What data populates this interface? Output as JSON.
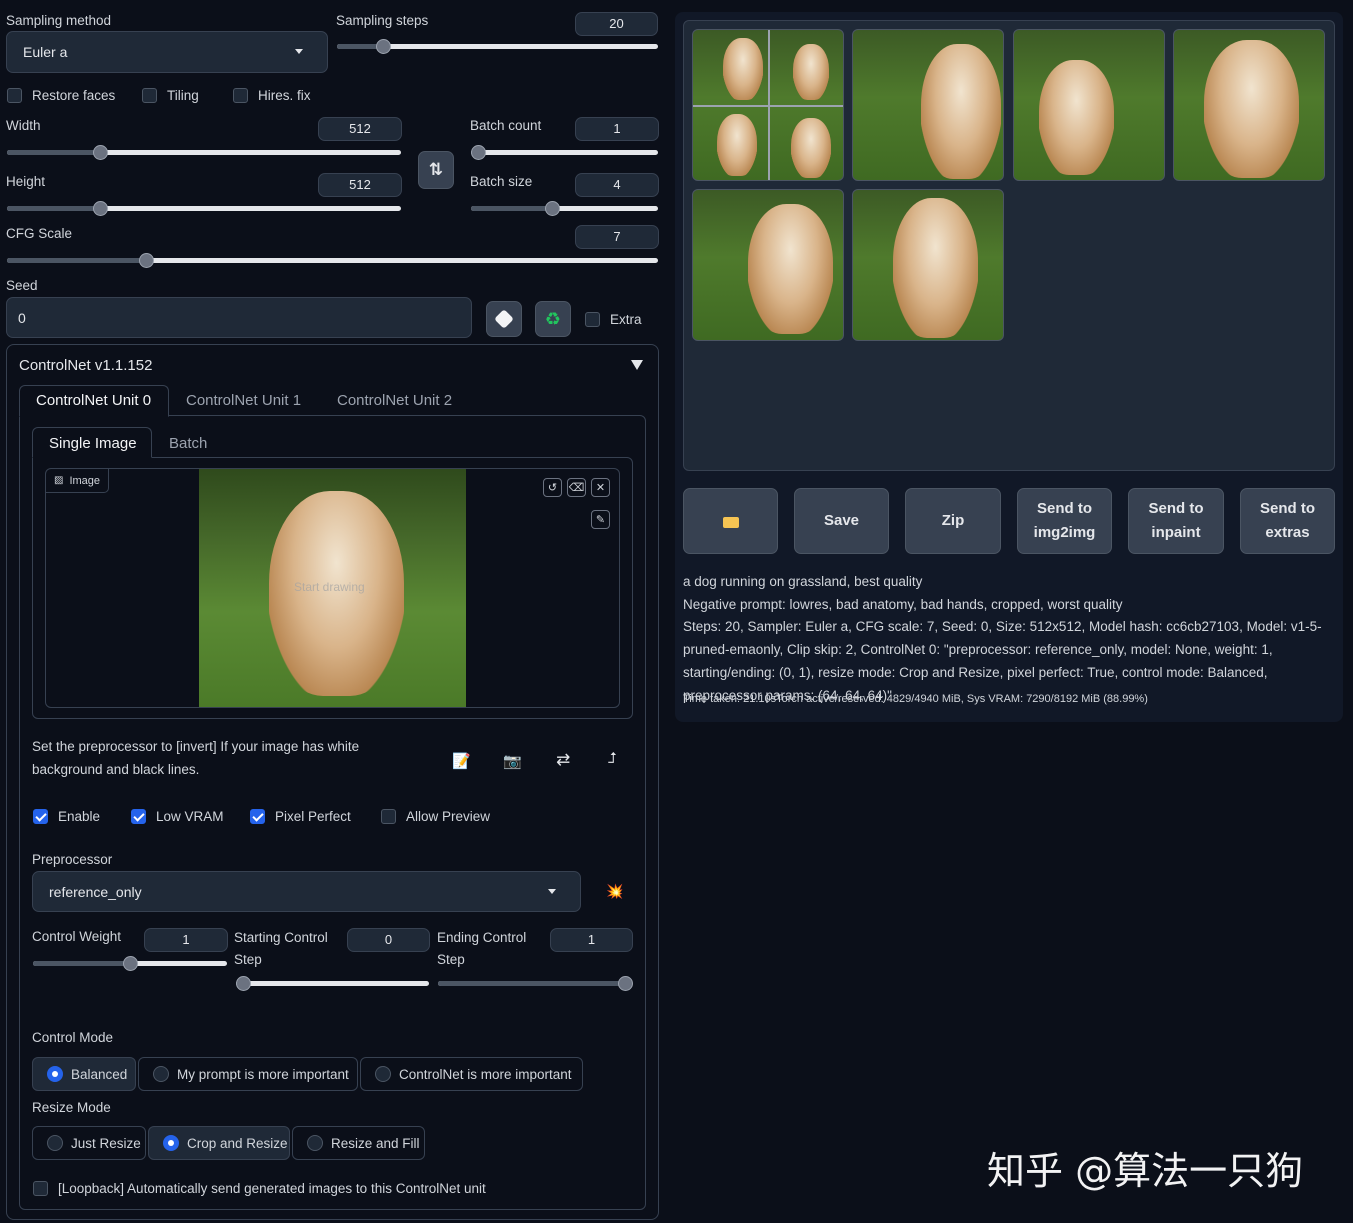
{
  "sampling": {
    "method_label": "Sampling method",
    "method_value": "Euler a",
    "steps_label": "Sampling steps",
    "steps_value": "20",
    "steps_fraction": 0.15
  },
  "options": {
    "restore_faces": "Restore faces",
    "tiling": "Tiling",
    "hires_fix": "Hires. fix"
  },
  "size": {
    "width_label": "Width",
    "width_value": "512",
    "height_label": "Height",
    "height_value": "512",
    "batch_count_label": "Batch count",
    "batch_count_value": "1",
    "batch_size_label": "Batch size",
    "batch_size_value": "4",
    "swap_icon": "swap-vertical-icon"
  },
  "cfg": {
    "label": "CFG Scale",
    "value": "7"
  },
  "seed": {
    "label": "Seed",
    "value": "0",
    "dice_icon": "dice-icon",
    "recycle_icon": "recycle-icon",
    "extra_label": "Extra"
  },
  "controlnet": {
    "title": "ControlNet v1.1.152",
    "units": [
      "ControlNet Unit 0",
      "ControlNet Unit 1",
      "ControlNet Unit 2"
    ],
    "image_tabs": [
      "Single Image",
      "Batch"
    ],
    "image_label": "Image",
    "canvas_hint": "Start drawing",
    "hint_text": "Set the preprocessor to [invert] If your image has white background and black lines.",
    "tool_icons": [
      "notepad-icon",
      "camera-icon",
      "swap-arrows-icon",
      "return-arrow-icon"
    ],
    "enable": "Enable",
    "low_vram": "Low VRAM",
    "pixel_perfect": "Pixel Perfect",
    "allow_preview": "Allow Preview",
    "preprocessor_label": "Preprocessor",
    "preprocessor_value": "reference_only",
    "explosion_icon": "explosion-icon",
    "control_weight_label": "Control Weight",
    "control_weight_value": "1",
    "start_step_label": "Starting Control Step",
    "start_step_value": "0",
    "end_step_label": "Ending Control Step",
    "end_step_value": "1",
    "control_mode_label": "Control Mode",
    "control_modes": [
      "Balanced",
      "My prompt is more important",
      "ControlNet is more important"
    ],
    "resize_mode_label": "Resize Mode",
    "resize_modes": [
      "Just Resize",
      "Crop and Resize",
      "Resize and Fill"
    ],
    "loopback": "[Loopback] Automatically send generated images to this ControlNet unit"
  },
  "actions": {
    "folder_icon": "folder-icon",
    "save": "Save",
    "zip": "Zip",
    "send_img2img": "Send to img2img",
    "send_inpaint": "Send to inpaint",
    "send_extras": "Send to extras"
  },
  "info": {
    "prompt": "a dog running on grassland, best quality",
    "negative": "Negative prompt: lowres, bad anatomy, bad hands, cropped, worst quality",
    "params": "Steps: 20, Sampler: Euler a, CFG scale: 7, Seed: 0, Size: 512x512, Model hash: cc6cb27103, Model: v1-5-pruned-emaonly, Clip skip: 2, ControlNet 0: \"preprocessor: reference_only, model: None, weight: 1, starting/ending: (0, 1), resize mode: Crop and Resize, pixel perfect: True, control mode: Balanced, preprocessor params: (64, 64, 64)\"",
    "time": "Time taken: 21.10sTorch active/reserved: 4829/4940 MiB, Sys VRAM: 7290/8192 MiB (88.99%)"
  },
  "watermark": "知乎 @算法一只狗"
}
